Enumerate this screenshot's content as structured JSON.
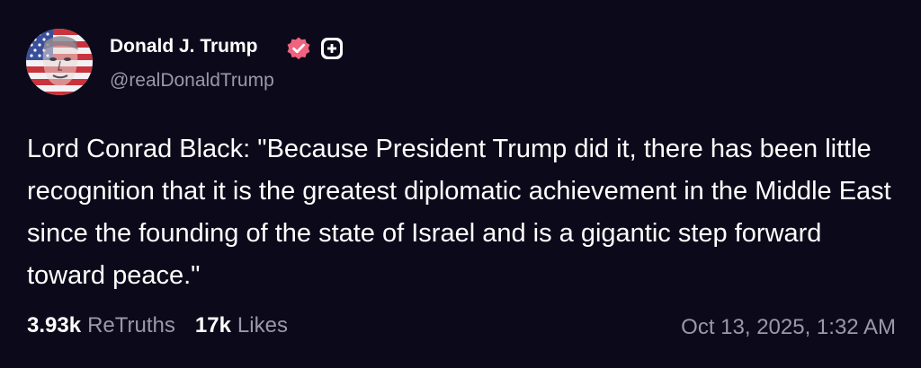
{
  "author": {
    "display_name": "Donald J. Trump",
    "handle": "@realDonaldTrump",
    "avatar_icon": "flag-portrait-avatar",
    "verified_icon": "verified-badge-icon",
    "plus_icon": "plus-badge-icon"
  },
  "post": {
    "text": "Lord Conrad Black: \"Because President Trump did it, there has been little recognition that it is the greatest diplomatic achievement in the Middle East since the founding of the state of Israel and is a gigantic step forward toward peace.\""
  },
  "stats": {
    "retruths_count": "3.93k",
    "retruths_label": "ReTruths",
    "likes_count": "17k",
    "likes_label": "Likes"
  },
  "timestamp": "Oct 13, 2025, 1:32 AM",
  "colors": {
    "background": "#0c0a1a",
    "text_primary": "#ffffff",
    "text_secondary": "#9b98a8",
    "verified_badge": "#f0637e"
  }
}
